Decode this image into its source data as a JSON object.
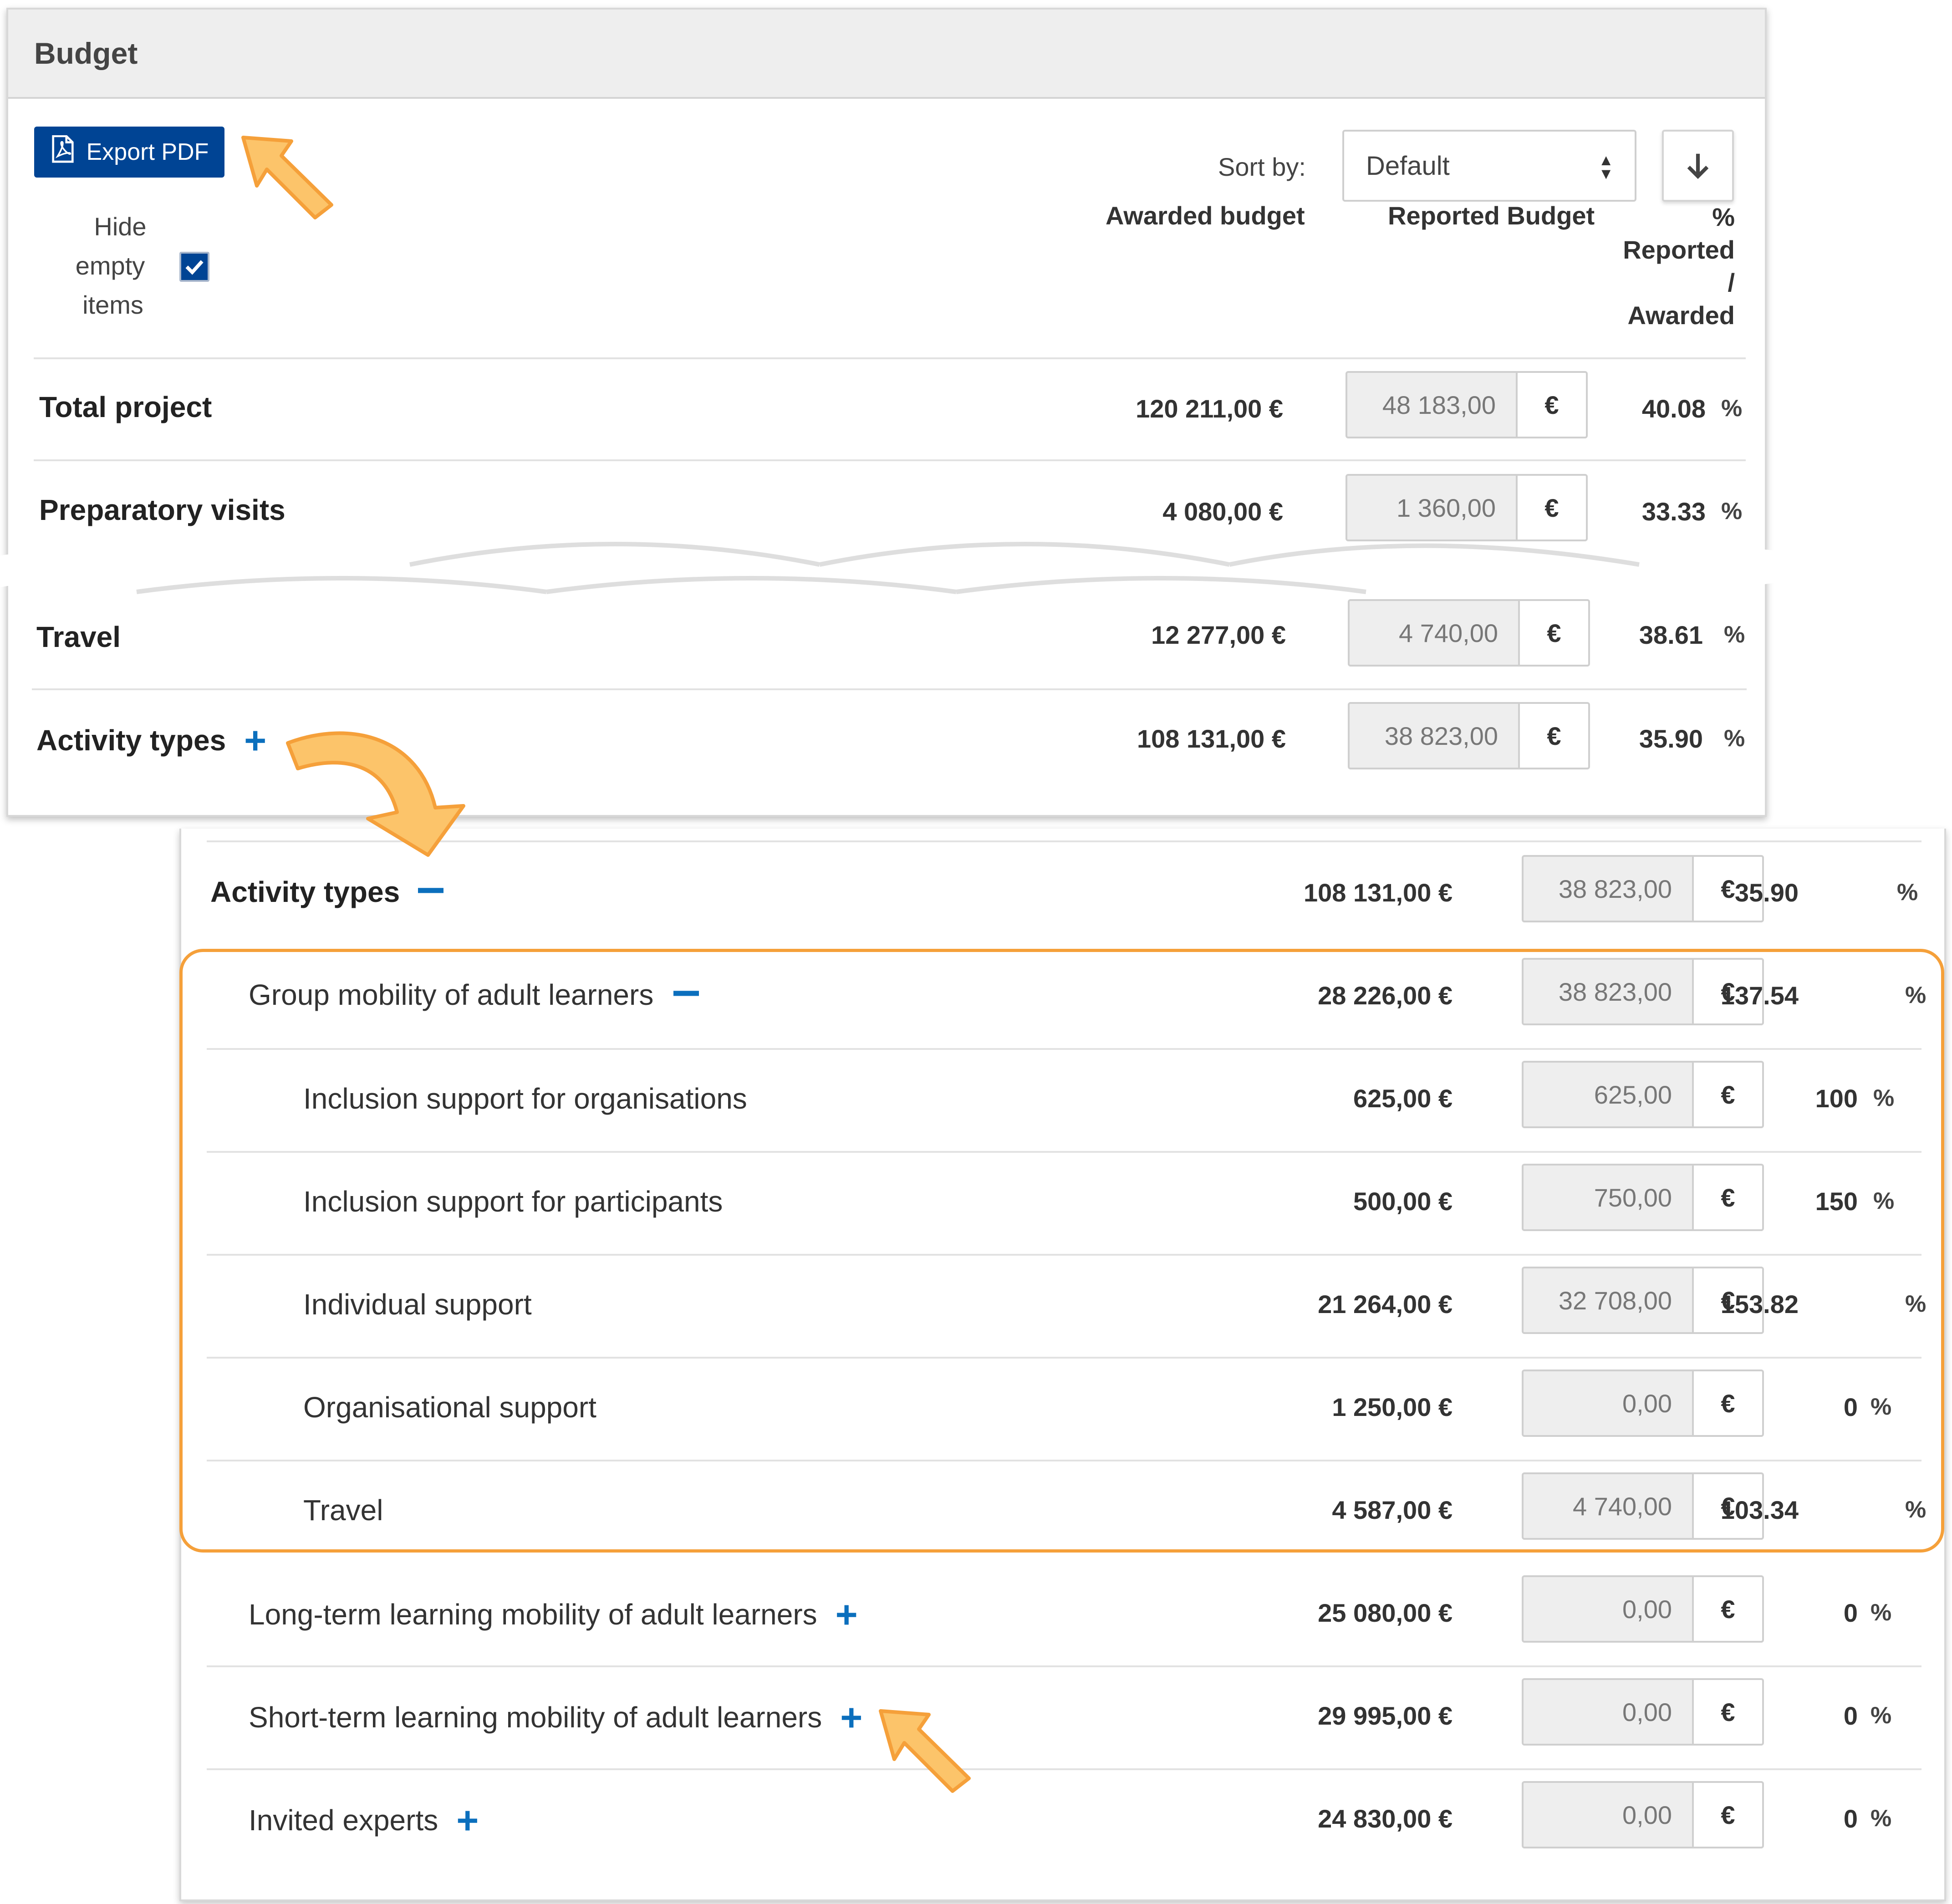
{
  "panel": {
    "title": "Budget"
  },
  "toolbar": {
    "export_label": "Export PDF",
    "hide_empty": {
      "line1": "Hide",
      "line2": "empty",
      "line3": "items",
      "checked": true
    },
    "sort_label": "Sort by:",
    "sort_value": "Default",
    "sort_direction_icon": "arrow-down-icon"
  },
  "columns": {
    "awarded": "Awarded budget",
    "reported": "Reported Budget",
    "pct_line1": "%",
    "pct_line2": "Reported",
    "pct_line3": "/",
    "pct_line4": "Awarded"
  },
  "currency_symbol": "€",
  "percent_symbol": "%",
  "top_rows": [
    {
      "label": "Total project",
      "awarded": "120 211,00 €",
      "reported": "48 183,00",
      "pct": "40.08"
    },
    {
      "label": "Preparatory visits",
      "awarded": "4 080,00 €",
      "reported": "1 360,00",
      "pct": "33.33"
    },
    {
      "label": "Travel",
      "awarded": "12 277,00 €",
      "reported": "4 740,00",
      "pct": "38.61"
    },
    {
      "label": "Activity types",
      "awarded": "108 131,00 €",
      "reported": "38 823,00",
      "pct": "35.90"
    }
  ],
  "expanded_rows": [
    {
      "label": "Activity types",
      "awarded": "108 131,00 €",
      "reported": "38 823,00",
      "pct": "35.90"
    },
    {
      "label": "Group mobility of adult learners",
      "awarded": "28 226,00 €",
      "reported": "38 823,00",
      "pct": "137.54"
    },
    {
      "label": "Inclusion support for organisations",
      "awarded": "625,00 €",
      "reported": "625,00",
      "pct": "100"
    },
    {
      "label": "Inclusion support for participants",
      "awarded": "500,00 €",
      "reported": "750,00",
      "pct": "150"
    },
    {
      "label": "Individual support",
      "awarded": "21 264,00 €",
      "reported": "32 708,00",
      "pct": "153.82"
    },
    {
      "label": "Organisational support",
      "awarded": "1 250,00 €",
      "reported": "0,00",
      "pct": "0"
    },
    {
      "label": "Travel",
      "awarded": "4 587,00 €",
      "reported": "4 740,00",
      "pct": "103.34"
    },
    {
      "label": "Long-term learning mobility of adult learners",
      "awarded": "25 080,00 €",
      "reported": "0,00",
      "pct": "0"
    },
    {
      "label": "Short-term learning mobility of adult learners",
      "awarded": "29 995,00 €",
      "reported": "0,00",
      "pct": "0"
    },
    {
      "label": "Invited experts",
      "awarded": "24 830,00 €",
      "reported": "0,00",
      "pct": "0"
    }
  ],
  "colors": {
    "primary": "#004494",
    "expand_icon": "#0b6fbd",
    "highlight": "#f5a03a",
    "arrow_fill": "#fcc46a"
  }
}
